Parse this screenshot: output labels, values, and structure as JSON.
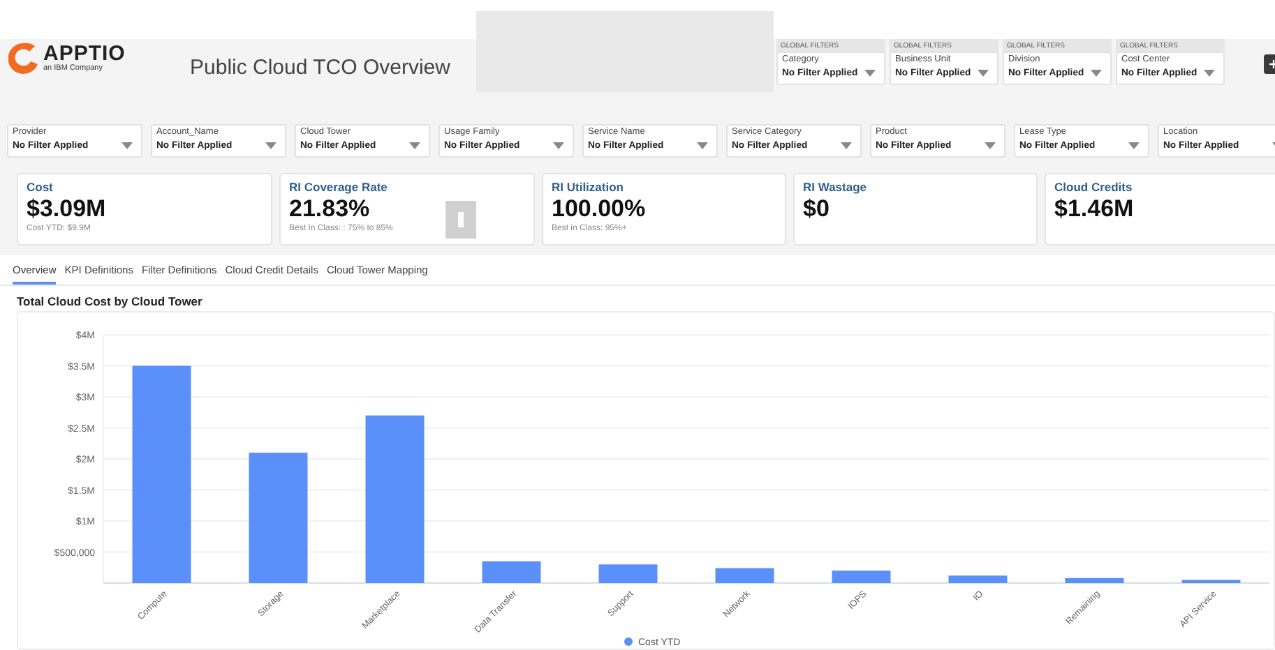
{
  "header": {
    "logo_text": "APPTIO",
    "logo_subtitle": "an IBM Company",
    "title": "Public Cloud TCO Overview"
  },
  "global_filters": [
    {
      "group": "GLOBAL FILTERS",
      "label": "Category",
      "value": "No Filter Applied"
    },
    {
      "group": "GLOBAL FILTERS",
      "label": "Business Unit",
      "value": "No Filter Applied"
    },
    {
      "group": "GLOBAL FILTERS",
      "label": "Division",
      "value": "No Filter Applied"
    },
    {
      "group": "GLOBAL FILTERS",
      "label": "Cost Center",
      "value": "No Filter Applied"
    }
  ],
  "filters": [
    {
      "label": "Provider",
      "value": "No Filter Applied"
    },
    {
      "label": "Account_Name",
      "value": "No Filter Applied"
    },
    {
      "label": "Cloud Tower",
      "value": "No Filter Applied"
    },
    {
      "label": "Usage Family",
      "value": "No Filter Applied"
    },
    {
      "label": "Service Name",
      "value": "No Filter Applied"
    },
    {
      "label": "Service Category",
      "value": "No Filter Applied"
    },
    {
      "label": "Product",
      "value": "No Filter Applied"
    },
    {
      "label": "Lease Type",
      "value": "No Filter Applied"
    },
    {
      "label": "Location",
      "value": "No Filter Applied"
    }
  ],
  "kpis": [
    {
      "title": "Cost",
      "value": "$3.09M",
      "note": "Cost YTD: $9.9M"
    },
    {
      "title": "RI Coverage Rate",
      "value": "21.83%",
      "note": "Best In Class: : 75% to 85%"
    },
    {
      "title": "RI Utilization",
      "value": "100.00%",
      "note": "Best in Class: 95%+"
    },
    {
      "title": "RI Wastage",
      "value": "$0"
    },
    {
      "title": "Cloud Credits",
      "value": "$1.46M"
    }
  ],
  "tabs": [
    {
      "label": "Overview",
      "selected": true
    },
    {
      "label": "KPI Definitions",
      "selected": false
    },
    {
      "label": "Filter Definitions",
      "selected": false
    },
    {
      "label": "Cloud Credit Details",
      "selected": false
    },
    {
      "label": "Cloud Tower Mapping",
      "selected": false
    }
  ],
  "chart": {
    "title": "Total Cloud Cost by Cloud Tower",
    "chart_data": {
      "type": "bar",
      "categories": [
        "Compute",
        "Storage",
        "Marketplace",
        "Data Transfer",
        "Support",
        "Network",
        "IOPS",
        "IO",
        "Remaining",
        "API Service"
      ],
      "series": [
        {
          "name": "Cost YTD",
          "color": "#5b8ff9",
          "values": [
            3500000,
            2100000,
            2700000,
            350000,
            300000,
            240000,
            200000,
            120000,
            80000,
            50000
          ]
        }
      ],
      "ylim": [
        0,
        4000000
      ],
      "grid": true,
      "yticks": [
        {
          "value": 500000,
          "label": "$500,000"
        },
        {
          "value": 1000000,
          "label": "$1M"
        },
        {
          "value": 1500000,
          "label": "$1.5M"
        },
        {
          "value": 2000000,
          "label": "$2M"
        },
        {
          "value": 2500000,
          "label": "$2.5M"
        },
        {
          "value": 3000000,
          "label": "$3M"
        },
        {
          "value": 3500000,
          "label": "$3.5M"
        },
        {
          "value": 4000000,
          "label": "$4M"
        }
      ]
    }
  }
}
